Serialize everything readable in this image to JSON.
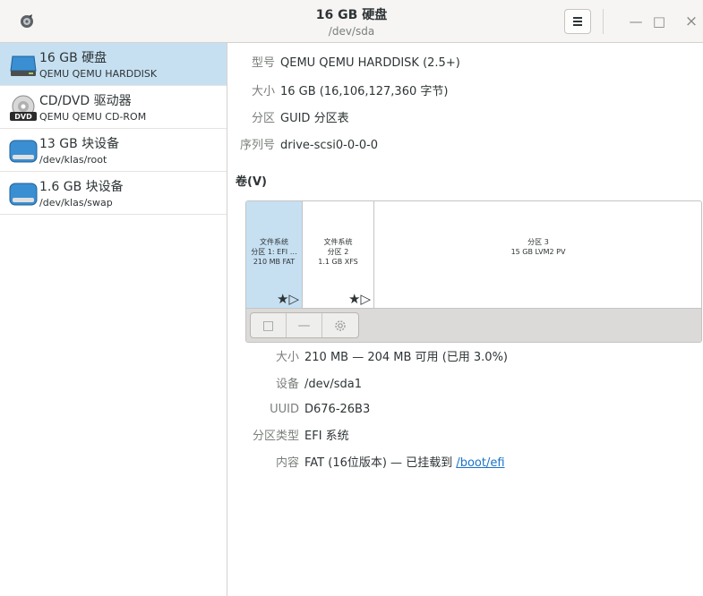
{
  "window": {
    "title": "16 GB 硬盘",
    "subtitle": "/dev/sda",
    "menu_icon": "hamburger-menu-icon",
    "minimize_label": "—",
    "maximize_label": "□",
    "close_label": "×"
  },
  "sidebar": {
    "items": [
      {
        "name": "16 GB 硬盘",
        "desc": "QEMU QEMU HARDDISK",
        "icon": "harddisk-icon",
        "selected": true
      },
      {
        "name": "CD/DVD 驱动器",
        "desc": "QEMU QEMU CD-ROM",
        "icon": "dvd-icon",
        "selected": false
      },
      {
        "name": "13 GB 块设备",
        "desc": "/dev/klas/root",
        "icon": "block-device-icon",
        "selected": false
      },
      {
        "name": "1.6 GB 块设备",
        "desc": "/dev/klas/swap",
        "icon": "block-device-icon",
        "selected": false
      }
    ]
  },
  "drive": {
    "model_label": "型号",
    "model": "QEMU QEMU HARDDISK (2.5+)",
    "size_label": "大小",
    "size": "16 GB (16,106,127,360 字节)",
    "partitioning_label": "分区",
    "partitioning": "GUID 分区表",
    "serial_label": "序列号",
    "serial": "drive-scsi0-0-0-0"
  },
  "volumes": {
    "title": "卷(V)",
    "segments": [
      {
        "line1": "文件系统",
        "line2": "分区 1: EFI …",
        "line3": "210 MB FAT",
        "icons": "★▷",
        "selected": true
      },
      {
        "line1": "文件系统",
        "line2": "分区 2",
        "line3": "1.1 GB XFS",
        "icons": "★▷",
        "selected": false
      },
      {
        "line1": "分区 3",
        "line2": "15 GB LVM2 PV",
        "selected": false
      }
    ],
    "toolbar": {
      "stop_label": "□",
      "remove_label": "—",
      "settings_icon": "gear-icon"
    }
  },
  "partition": {
    "size_label": "大小",
    "size": "210 MB — 204 MB 可用 (已用 3.0%)",
    "device_label": "设备",
    "device": "/dev/sda1",
    "uuid_label": "UUID",
    "uuid": "D676-26B3",
    "type_label": "分区类型",
    "type": "EFI 系统",
    "contents_label": "内容",
    "contents_prefix": "FAT (16位版本) — 已挂载到 ",
    "contents_link": "/boot/efi"
  },
  "colors": {
    "selected": "#c6e0f1",
    "link": "#1a73c9",
    "header_bg": "#f6f5f4"
  }
}
